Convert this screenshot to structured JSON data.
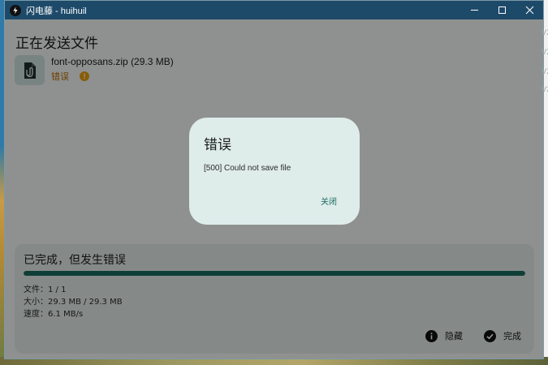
{
  "window": {
    "title": "闪电藤 - huihuil"
  },
  "main": {
    "heading": "正在发送文件",
    "file": {
      "name": "font-opposans.zip (29.3 MB)",
      "status": "错误"
    }
  },
  "summary": {
    "title": "已完成，但发生错误",
    "progress_fraction": 1.0,
    "files_line": "文件：1 / 1",
    "size_line": "大小：29.3 MB / 29.3 MB",
    "speed_line": "速度：6.1 MB/s",
    "hide_label": "隐藏",
    "done_label": "完成"
  },
  "dialog": {
    "title": "错误",
    "message": "[500] Could not save file",
    "close_label": "关闭"
  },
  "colors": {
    "titlebar": "#1e4a6a",
    "accent": "#1a6b60",
    "error_text": "#b86a00",
    "warning_icon": "#e9a10f",
    "dialog_bg": "#deecea"
  },
  "icons": {
    "app": "lightning-vine-app-icon",
    "file": "zip-file-icon",
    "status": "info-icon",
    "hide": "info-circle-icon",
    "done": "check-circle-icon"
  }
}
